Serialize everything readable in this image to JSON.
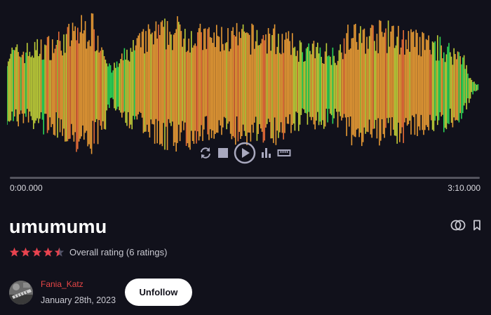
{
  "player": {
    "time_start": "0:00.000",
    "time_end": "3:10.000",
    "colors": {
      "wave_green": "#2de05a",
      "wave_yellow": "#c8d83a",
      "wave_orange": "#f3a236",
      "wave_red": "#f2713a",
      "track": "#54545e",
      "icons": "#a9a9bf"
    },
    "controls": [
      {
        "name": "loop-icon"
      },
      {
        "name": "stop-icon"
      },
      {
        "name": "play-icon"
      },
      {
        "name": "spectrum-icon"
      },
      {
        "name": "ruler-icon"
      }
    ]
  },
  "track": {
    "title": "umumumu",
    "rating_value": 4.5,
    "rating_max": 5,
    "rating_text": "Overall rating (6 ratings)",
    "star_color": "#e8434f",
    "actions": [
      {
        "name": "compare-icon"
      },
      {
        "name": "bookmark-icon"
      }
    ]
  },
  "author": {
    "name": "Fania_Katz",
    "date": "January 28th, 2023",
    "name_color": "#e84646"
  },
  "follow_button": {
    "label": "Unfollow"
  }
}
